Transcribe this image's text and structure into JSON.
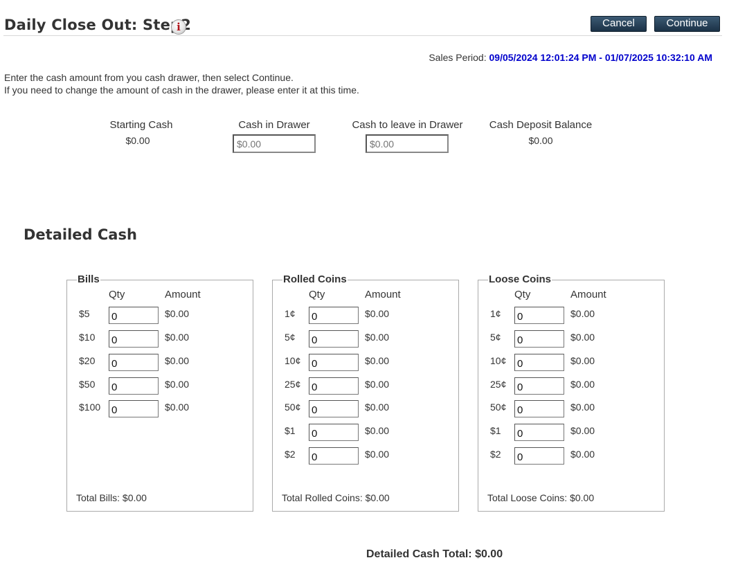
{
  "header": {
    "title": "Daily Close Out: Step2",
    "info_icon": "info-icon",
    "cancel_label": "Cancel",
    "continue_label": "Continue",
    "sales_period_label": "Sales Period:",
    "sales_period_value": "09/05/2024 12:01:24 PM - 01/07/2025 10:32:10 AM"
  },
  "instructions": {
    "line1": "Enter the cash amount from you cash drawer, then select Continue.",
    "line2": "If you need to change the amount of cash in the drawer, please enter it at this time."
  },
  "summary": {
    "starting_cash_label": "Starting Cash",
    "starting_cash_value": "$0.00",
    "cash_in_drawer_label": "Cash in Drawer",
    "cash_in_drawer_placeholder": "$0.00",
    "cash_to_leave_label": "Cash to leave in Drawer",
    "cash_to_leave_placeholder": "$0.00",
    "deposit_balance_label": "Cash Deposit Balance",
    "deposit_balance_value": "$0.00"
  },
  "detailed": {
    "title": "Detailed Cash",
    "qty_header": "Qty",
    "amount_header": "Amount",
    "bills": {
      "legend": "Bills",
      "rows": [
        {
          "label": "$5",
          "qty": "0",
          "amount": "$0.00"
        },
        {
          "label": "$10",
          "qty": "0",
          "amount": "$0.00"
        },
        {
          "label": "$20",
          "qty": "0",
          "amount": "$0.00"
        },
        {
          "label": "$50",
          "qty": "0",
          "amount": "$0.00"
        },
        {
          "label": "$100",
          "qty": "0",
          "amount": "$0.00"
        }
      ],
      "total": "Total Bills: $0.00"
    },
    "rolled": {
      "legend": "Rolled Coins",
      "rows": [
        {
          "label": "1¢",
          "qty": "0",
          "amount": "$0.00"
        },
        {
          "label": "5¢",
          "qty": "0",
          "amount": "$0.00"
        },
        {
          "label": "10¢",
          "qty": "0",
          "amount": "$0.00"
        },
        {
          "label": "25¢",
          "qty": "0",
          "amount": "$0.00"
        },
        {
          "label": "50¢",
          "qty": "0",
          "amount": "$0.00"
        },
        {
          "label": "$1",
          "qty": "0",
          "amount": "$0.00"
        },
        {
          "label": "$2",
          "qty": "0",
          "amount": "$0.00"
        }
      ],
      "total": "Total Rolled Coins: $0.00"
    },
    "loose": {
      "legend": "Loose Coins",
      "rows": [
        {
          "label": "1¢",
          "qty": "0",
          "amount": "$0.00"
        },
        {
          "label": "5¢",
          "qty": "0",
          "amount": "$0.00"
        },
        {
          "label": "10¢",
          "qty": "0",
          "amount": "$0.00"
        },
        {
          "label": "25¢",
          "qty": "0",
          "amount": "$0.00"
        },
        {
          "label": "50¢",
          "qty": "0",
          "amount": "$0.00"
        },
        {
          "label": "$1",
          "qty": "0",
          "amount": "$0.00"
        },
        {
          "label": "$2",
          "qty": "0",
          "amount": "$0.00"
        }
      ],
      "total": "Total Loose Coins: $0.00"
    },
    "grand_total": "Detailed Cash Total: $0.00"
  },
  "colors": {
    "period_blue": "#0000cc",
    "button_navy": "#1b3247",
    "info_red": "#b0141a"
  }
}
